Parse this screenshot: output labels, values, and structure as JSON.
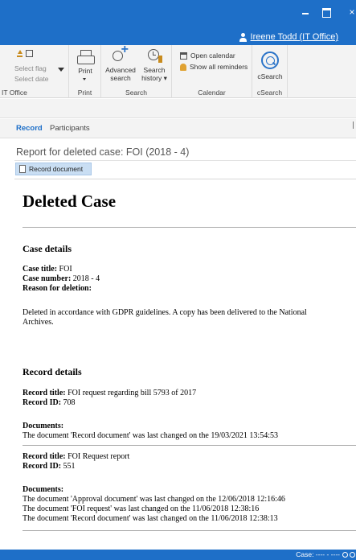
{
  "titlebar": {
    "username": "Ireene Todd (IT Office)"
  },
  "ribbon": {
    "group1": {
      "select_flag": "Select flag",
      "select_date": "Select date",
      "label": "IT Office"
    },
    "print": {
      "button": "Print",
      "label": "Print"
    },
    "search": {
      "advanced_line1": "Advanced",
      "advanced_line2": "search",
      "history_line1": "Search",
      "history_line2": "history",
      "label": "Search"
    },
    "calendar": {
      "open": "Open calendar",
      "reminders": "Show all reminders",
      "label": "Calendar"
    },
    "csearch": {
      "button": "cSearch",
      "label": "cSearch"
    }
  },
  "tabs": {
    "record": "Record",
    "participants": "Participants"
  },
  "report": {
    "title": "Report for deleted case: FOI (2018 - 4)",
    "doc_button": "Record document"
  },
  "document": {
    "heading": "Deleted Case",
    "case_details": {
      "heading": "Case details",
      "title_label": "Case title:",
      "title_value": "FOI",
      "number_label": "Case number:",
      "number_value": "2018 - 4",
      "reason_label": "Reason for deletion:",
      "reason_text": "Deleted in accordance with GDPR guidelines. A copy has been delivered to the National Archives."
    },
    "record_details": {
      "heading": "Record details",
      "records": [
        {
          "title_label": "Record title:",
          "title_value": "FOI request regarding bill 5793 of 2017",
          "id_label": "Record ID:",
          "id_value": "708",
          "docs_label": "Documents:",
          "docs": [
            "The document 'Record document' was last changed on the 19/03/2021 13:54:53"
          ]
        },
        {
          "title_label": "Record title:",
          "title_value": "FOI Request report",
          "id_label": "Record ID:",
          "id_value": "551",
          "docs_label": "Documents:",
          "docs": [
            "The document 'Approval document' was last changed on the 12/06/2018 12:16:46",
            "The document 'FOI request' was last changed on the 11/06/2018 12:38:16",
            "The document 'Record document' was last changed on the 11/06/2018 12:38:13"
          ]
        }
      ]
    }
  },
  "statusbar": {
    "text": "Case: ---- - ----"
  },
  "colors": {
    "accent": "#1e6fc8",
    "selection": "#c9def3"
  }
}
